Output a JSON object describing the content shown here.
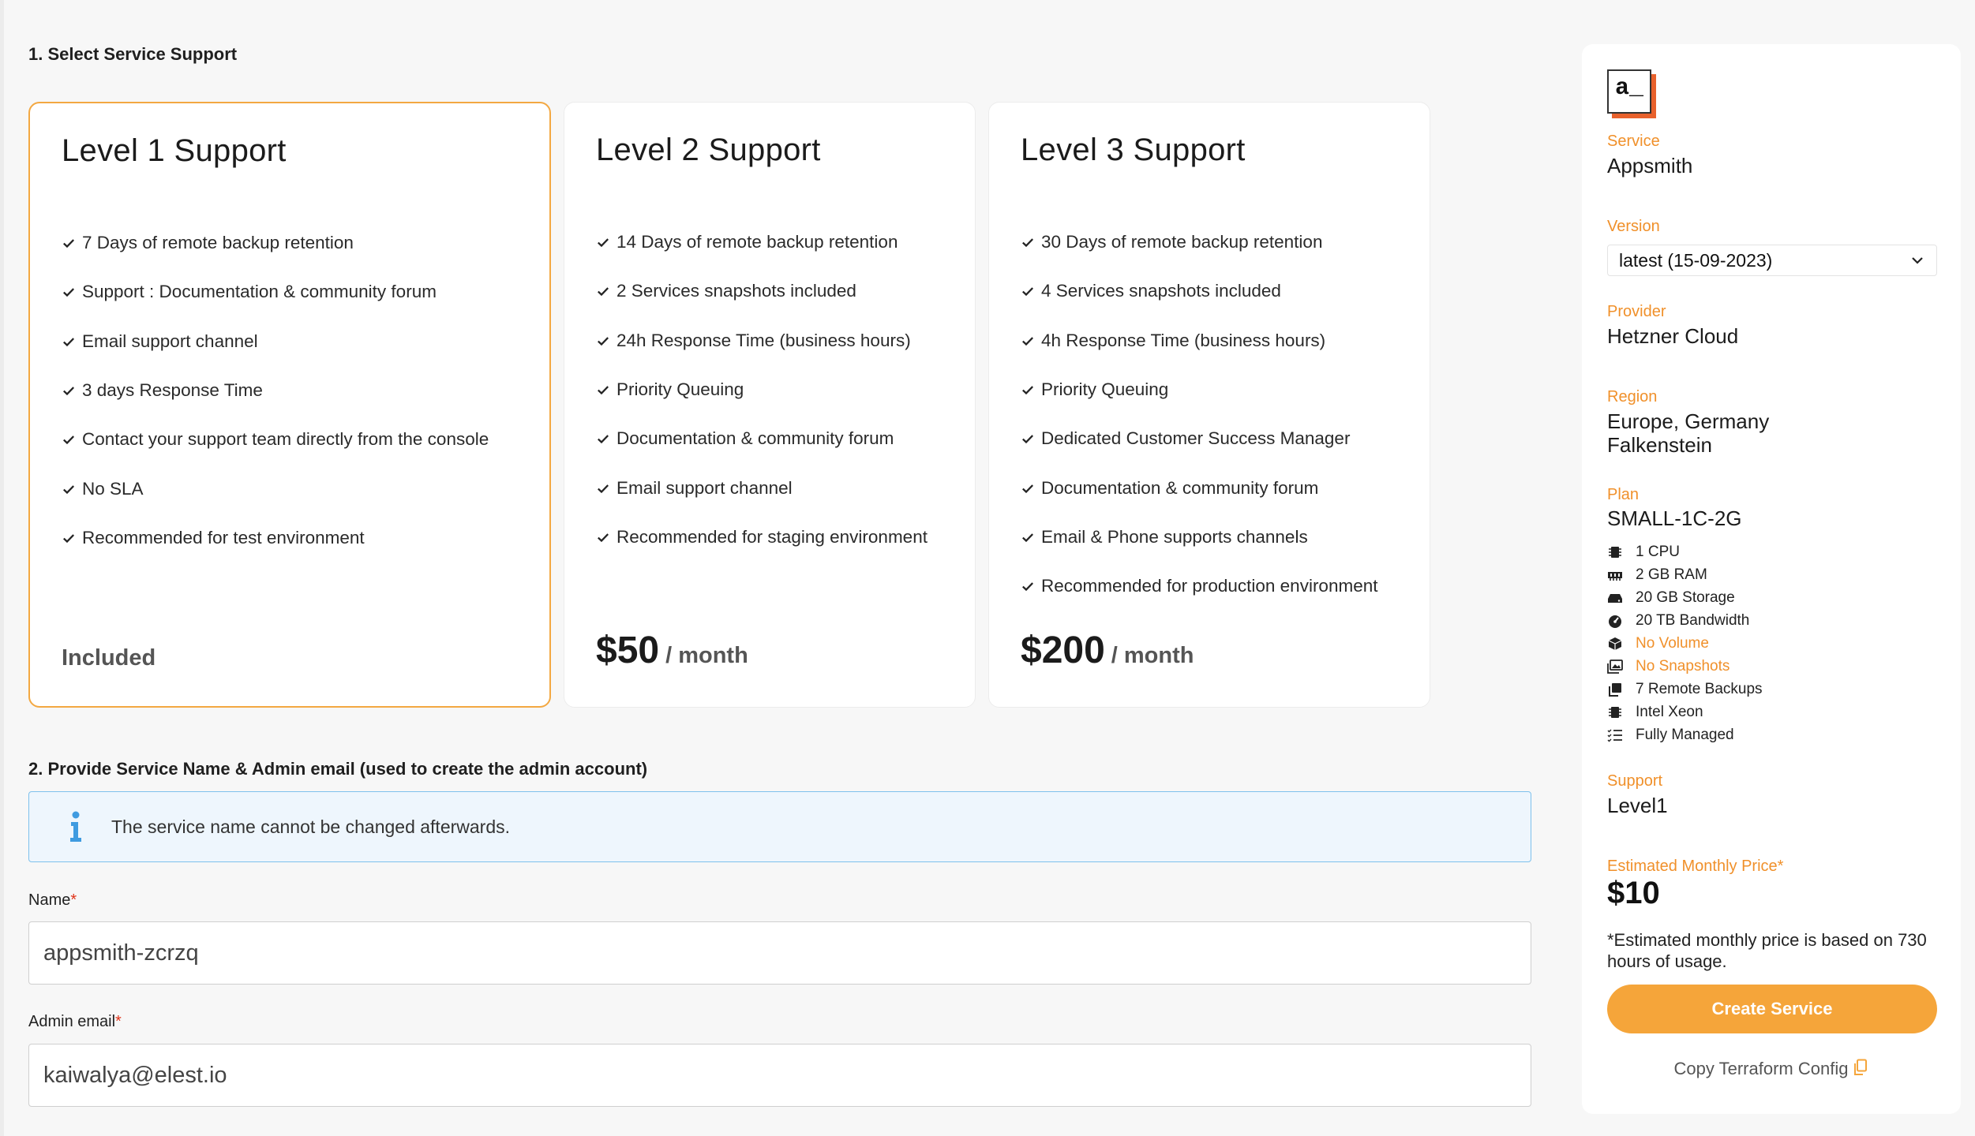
{
  "section1": {
    "title": "1. Select Service Support"
  },
  "plans": [
    {
      "title": "Level 1 Support",
      "features": [
        "7 Days of remote backup retention",
        "Support : Documentation & community forum",
        "Email support channel",
        "3 days Response Time",
        "Contact your support team directly from the console",
        "No SLA",
        "Recommended for test environment"
      ],
      "price_text": "Included",
      "selected": true
    },
    {
      "title": "Level 2 Support",
      "features": [
        "14 Days of remote backup retention",
        "2 Services snapshots included",
        "24h Response Time (business hours)",
        "Priority Queuing",
        "Documentation & community forum",
        "Email support channel",
        "Recommended for staging environment"
      ],
      "price": "$50",
      "price_unit": "/ month",
      "selected": false
    },
    {
      "title": "Level 3 Support",
      "features": [
        "30 Days of remote backup retention",
        "4 Services snapshots included",
        "4h Response Time (business hours)",
        "Priority Queuing",
        "Dedicated Customer Success Manager",
        "Documentation & community forum",
        "Email & Phone supports channels",
        "Recommended for production environment"
      ],
      "price": "$200",
      "price_unit": "/ month",
      "selected": false
    }
  ],
  "section2": {
    "title": "2. Provide Service Name & Admin email (used to create the admin account)",
    "info": "The service name cannot be changed afterwards.",
    "name_label": "Name",
    "name_value": "appsmith-zcrzq",
    "email_label": "Admin email",
    "email_value": "kaiwalya@elest.io",
    "required_mark": "*"
  },
  "sidebar": {
    "logo_text": "a_",
    "service_label": "Service",
    "service_value": "Appsmith",
    "version_label": "Version",
    "version_value": "latest (15-09-2023)",
    "provider_label": "Provider",
    "provider_value": "Hetzner Cloud",
    "region_label": "Region",
    "region_line1": "Europe, Germany",
    "region_line2": "Falkenstein",
    "plan_label": "Plan",
    "plan_value": "SMALL-1C-2G",
    "specs": [
      {
        "icon": "cpu-icon",
        "text": "1 CPU",
        "warn": false
      },
      {
        "icon": "memory-icon",
        "text": "2 GB RAM",
        "warn": false
      },
      {
        "icon": "hard-drive-icon",
        "text": "20 GB Storage",
        "warn": false
      },
      {
        "icon": "gauge-icon",
        "text": "20 TB Bandwidth",
        "warn": false
      },
      {
        "icon": "box-icon",
        "text": "No Volume",
        "warn": true
      },
      {
        "icon": "images-icon",
        "text": "No Snapshots",
        "warn": true
      },
      {
        "icon": "copy-icon",
        "text": "7 Remote Backups",
        "warn": false
      },
      {
        "icon": "chip-icon",
        "text": "Intel Xeon",
        "warn": false
      },
      {
        "icon": "list-check-icon",
        "text": "Fully Managed",
        "warn": false
      }
    ],
    "support_label": "Support",
    "support_value": "Level1",
    "est_label": "Estimated Monthly Price*",
    "est_value": "$10",
    "est_note": "*Estimated monthly price is based on 730 hours of usage.",
    "create_button": "Create Service",
    "copy_link": "Copy Terraform Config"
  },
  "colors": {
    "accent": "#f5a53a",
    "accent_text": "#f0902a",
    "selected_border": "#f3a842",
    "info_bg": "#eef6fd",
    "info_border": "#7ec1ec",
    "required": "#e0341a"
  }
}
